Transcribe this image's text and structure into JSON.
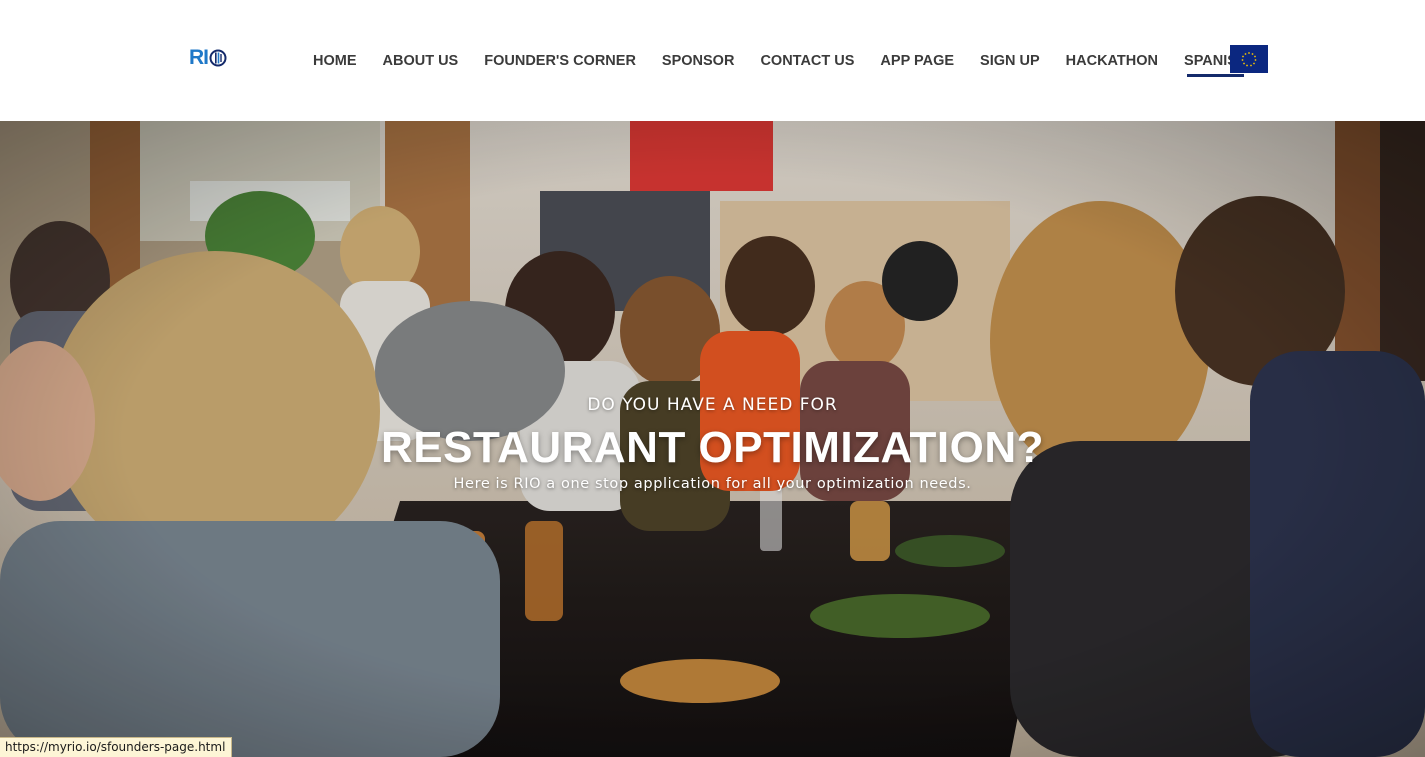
{
  "brand": {
    "logo_text": "RI",
    "logo_color": "#1f78c8",
    "logo_mark_icon": "rio-o-mark-icon"
  },
  "nav": {
    "items": [
      {
        "label": "HOME",
        "active": false
      },
      {
        "label": "ABOUT US",
        "active": false
      },
      {
        "label": "FOUNDER'S CORNER",
        "active": false
      },
      {
        "label": "SPONSOR",
        "active": false
      },
      {
        "label": "CONTACT US",
        "active": false
      },
      {
        "label": "APP PAGE",
        "active": false
      },
      {
        "label": "SIGN UP",
        "active": false
      },
      {
        "label": "HACKATHON",
        "active": false
      },
      {
        "label": "SPANISH",
        "active": true
      }
    ],
    "active_underline_color": "#142a6b",
    "flag_icon": "eu-flag-icon",
    "flag_color": "#0b2780"
  },
  "hero": {
    "kicker": "DO YOU HAVE A NEED FOR",
    "title": "RESTAURANT OPTIMIZATION?",
    "subtitle": "Here is RIO a one stop application for all your optimization needs.",
    "background_image": "people-dining-at-long-table-photo"
  },
  "status_bar": {
    "url": "https://myrio.io/sfounders-page.html"
  }
}
